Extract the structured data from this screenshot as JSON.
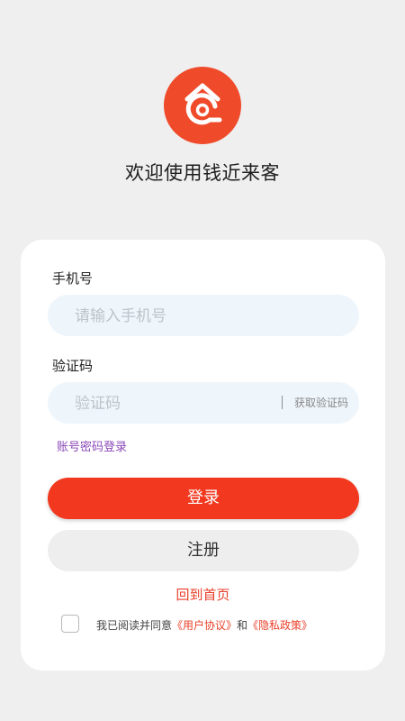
{
  "app": {
    "welcome": "欢迎使用钱近来客"
  },
  "form": {
    "phone_label": "手机号",
    "phone_placeholder": "请输入手机号",
    "phone_value": "",
    "code_label": "验证码",
    "code_placeholder": "验证码",
    "code_value": "",
    "get_code_label": "获取验证码",
    "password_login_link": "账号密码登录",
    "login_button": "登录",
    "register_button": "注册",
    "back_home_link": "回到首页"
  },
  "agreement": {
    "checked": false,
    "prefix": "我已阅读并同意",
    "user_agreement": "《用户协议》",
    "connector": "和",
    "privacy_policy": "《隐私政策》"
  },
  "colors": {
    "brand": "#ef4a2a",
    "login_button": "#f2381e",
    "link_purple": "#8a49b8",
    "field_bg": "#eef6fc",
    "page_bg": "#efefef"
  },
  "icons": {
    "logo": "app-logo-icon"
  }
}
